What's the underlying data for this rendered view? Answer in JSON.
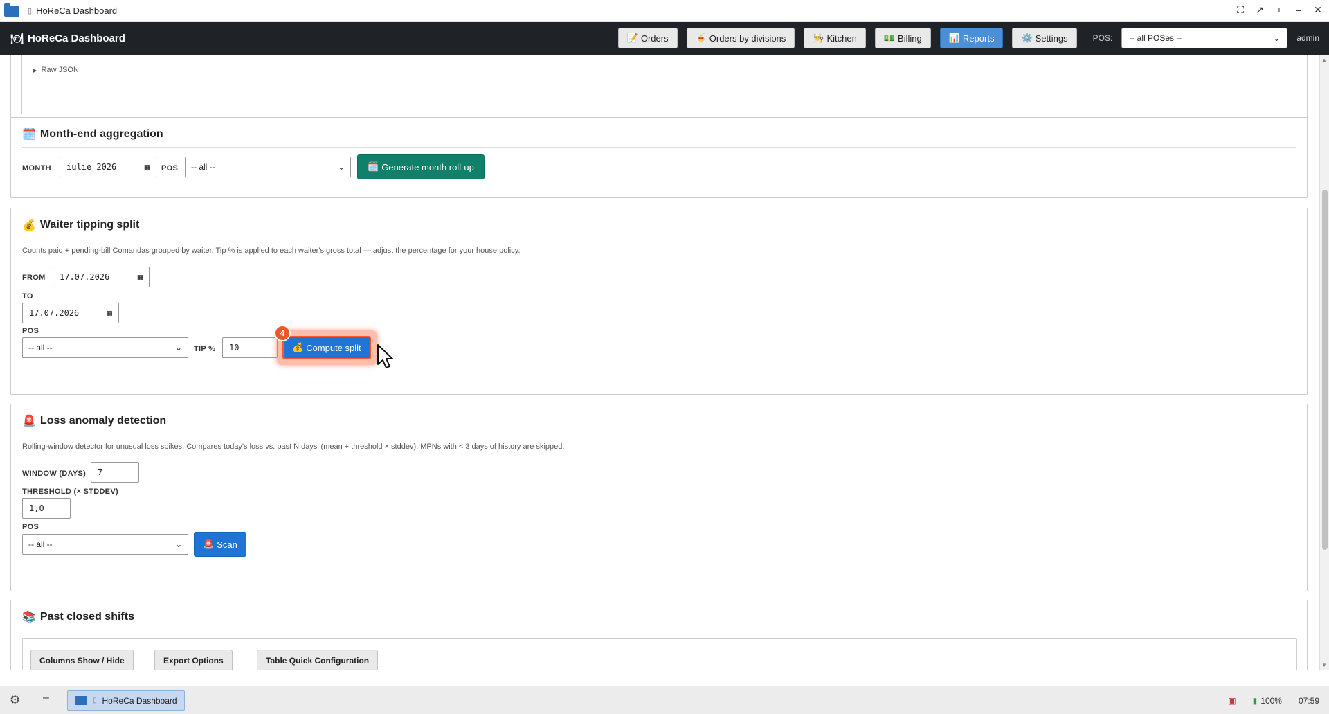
{
  "window": {
    "title": "HoReCa Dashboard"
  },
  "navbar": {
    "brand": "HoReCa Dashboard",
    "buttons": [
      {
        "icon": "📝",
        "label": "Orders"
      },
      {
        "icon": "🍝",
        "label": "Orders by divisions"
      },
      {
        "icon": "👨‍🍳",
        "label": "Kitchen"
      },
      {
        "icon": "💵",
        "label": "Billing"
      },
      {
        "icon": "📊",
        "label": "Reports",
        "active": true
      },
      {
        "icon": "⚙️",
        "label": "Settings"
      }
    ],
    "pos_label": "POS:",
    "pos_value": "-- all POSes --",
    "user": "admin"
  },
  "raw_json": {
    "label": "Raw JSON"
  },
  "month_end": {
    "icon": "🗓️",
    "title": "Month-end aggregation",
    "month_label": "MONTH",
    "month_value": "iulie 2026",
    "pos_label": "POS",
    "pos_value": "-- all --",
    "button_label": "Generate month roll-up",
    "button_icon": "🗓️"
  },
  "tipping": {
    "icon": "💰",
    "title": "Waiter tipping split",
    "description": "Counts paid + pending-bill Comandas grouped by waiter. Tip % is applied to each waiter's gross total — adjust the percentage for your house policy.",
    "from_label": "FROM",
    "from_value": "17.07.2026",
    "to_label": "TO",
    "to_value": "17.07.2026",
    "pos_label": "POS",
    "pos_value": "-- all --",
    "tip_label": "TIP %",
    "tip_value": "10",
    "button_label": "Compute split",
    "button_icon": "💰",
    "step_badge": "4"
  },
  "loss": {
    "icon": "🚨",
    "title": "Loss anomaly detection",
    "description": "Rolling-window detector for unusual loss spikes. Compares today's loss vs. past N days' (mean + threshold × stddev). MPNs with < 3 days of history are skipped.",
    "window_label": "WINDOW (DAYS)",
    "window_value": "7",
    "threshold_label": "THRESHOLD (× STDDEV)",
    "threshold_value": "1,0",
    "pos_label": "POS",
    "pos_value": "-- all --",
    "button_label": "Scan",
    "button_icon": "🚨"
  },
  "shifts": {
    "icon": "📚",
    "title": "Past closed shifts",
    "tabs": [
      "Columns Show / Hide",
      "Export Options",
      "Table Quick Configuration"
    ]
  },
  "taskbar": {
    "app_label": "HoReCa Dashboard",
    "battery": "100%",
    "time": "07:59"
  }
}
